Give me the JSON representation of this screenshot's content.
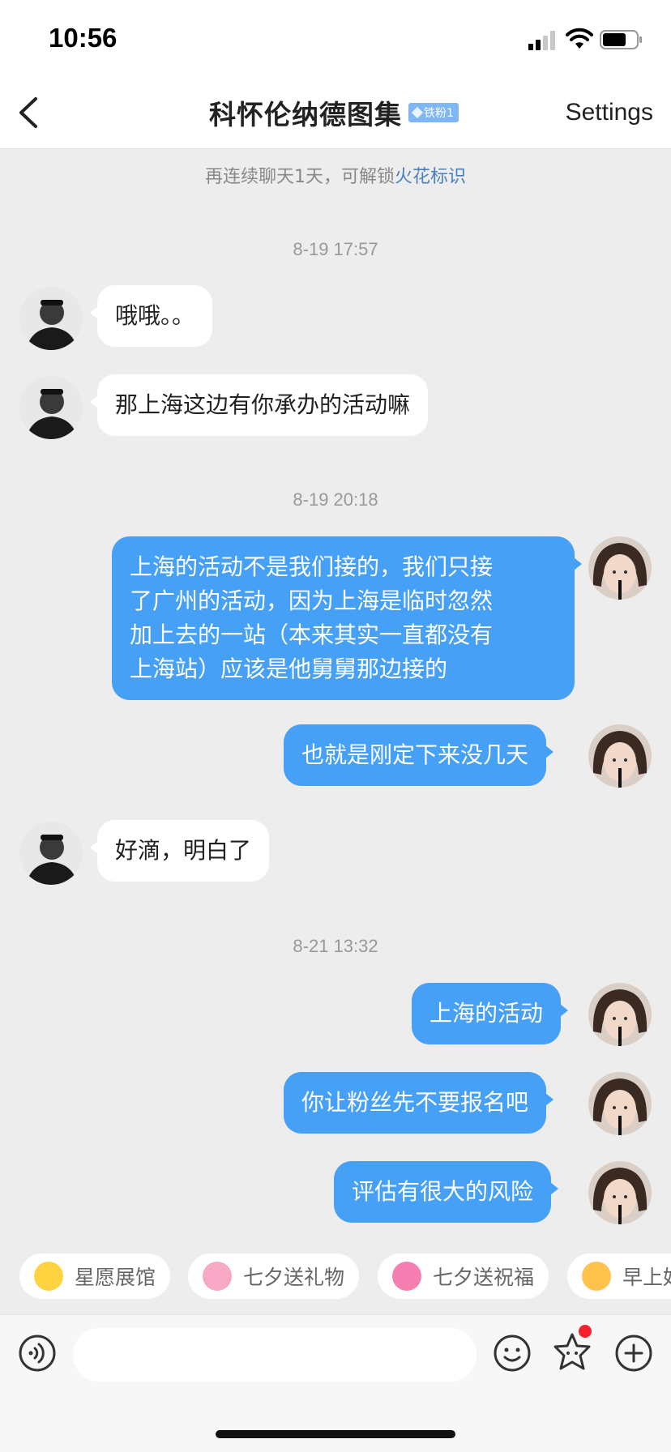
{
  "status_bar": {
    "time": "10:56"
  },
  "header": {
    "title": "科怀伦纳德图集",
    "badge": "铁粉1",
    "settings": "Settings"
  },
  "hint": {
    "text": "再连续聊天1天，可解锁",
    "highlight": "火花标识"
  },
  "timestamps": [
    "8-19 17:57",
    "8-19 20:18",
    "8-21 13:32"
  ],
  "messages": [
    {
      "side": "incoming",
      "lines": [
        "哦哦。。"
      ]
    },
    {
      "side": "incoming",
      "lines": [
        "那上海这边有你承办的活动嘛"
      ]
    },
    {
      "side": "outgoing",
      "lines": [
        "上海的活动不是我们接的，我们只接",
        "了广州的活动，因为上海是临时忽然",
        "加上去的一站（本来其实一直都没有",
        "上海站）应该是他舅舅那边接的"
      ]
    },
    {
      "side": "outgoing",
      "lines": [
        "也就是刚定下来没几天"
      ]
    },
    {
      "side": "incoming",
      "lines": [
        "好滴，明白了"
      ]
    },
    {
      "side": "outgoing",
      "lines": [
        "上海的活动"
      ]
    },
    {
      "side": "outgoing",
      "lines": [
        "你让粉丝先不要报名吧"
      ]
    },
    {
      "side": "outgoing",
      "lines": [
        "评估有很大的风险"
      ]
    }
  ],
  "quick_actions": [
    {
      "label": "星愿展馆",
      "icon": "star-face-icon"
    },
    {
      "label": "七夕送礼物",
      "icon": "couple-icon"
    },
    {
      "label": "七夕送祝福",
      "icon": "bird-icon"
    },
    {
      "label": "早上好",
      "icon": "sun-face-icon"
    }
  ],
  "input": {
    "placeholder": ""
  },
  "colors": {
    "outgoing_bubble": "#45a0f6",
    "incoming_bubble": "#ffffff",
    "background": "#ededed",
    "badge": "#7fb6f5",
    "highlight": "#4a7fc0"
  }
}
